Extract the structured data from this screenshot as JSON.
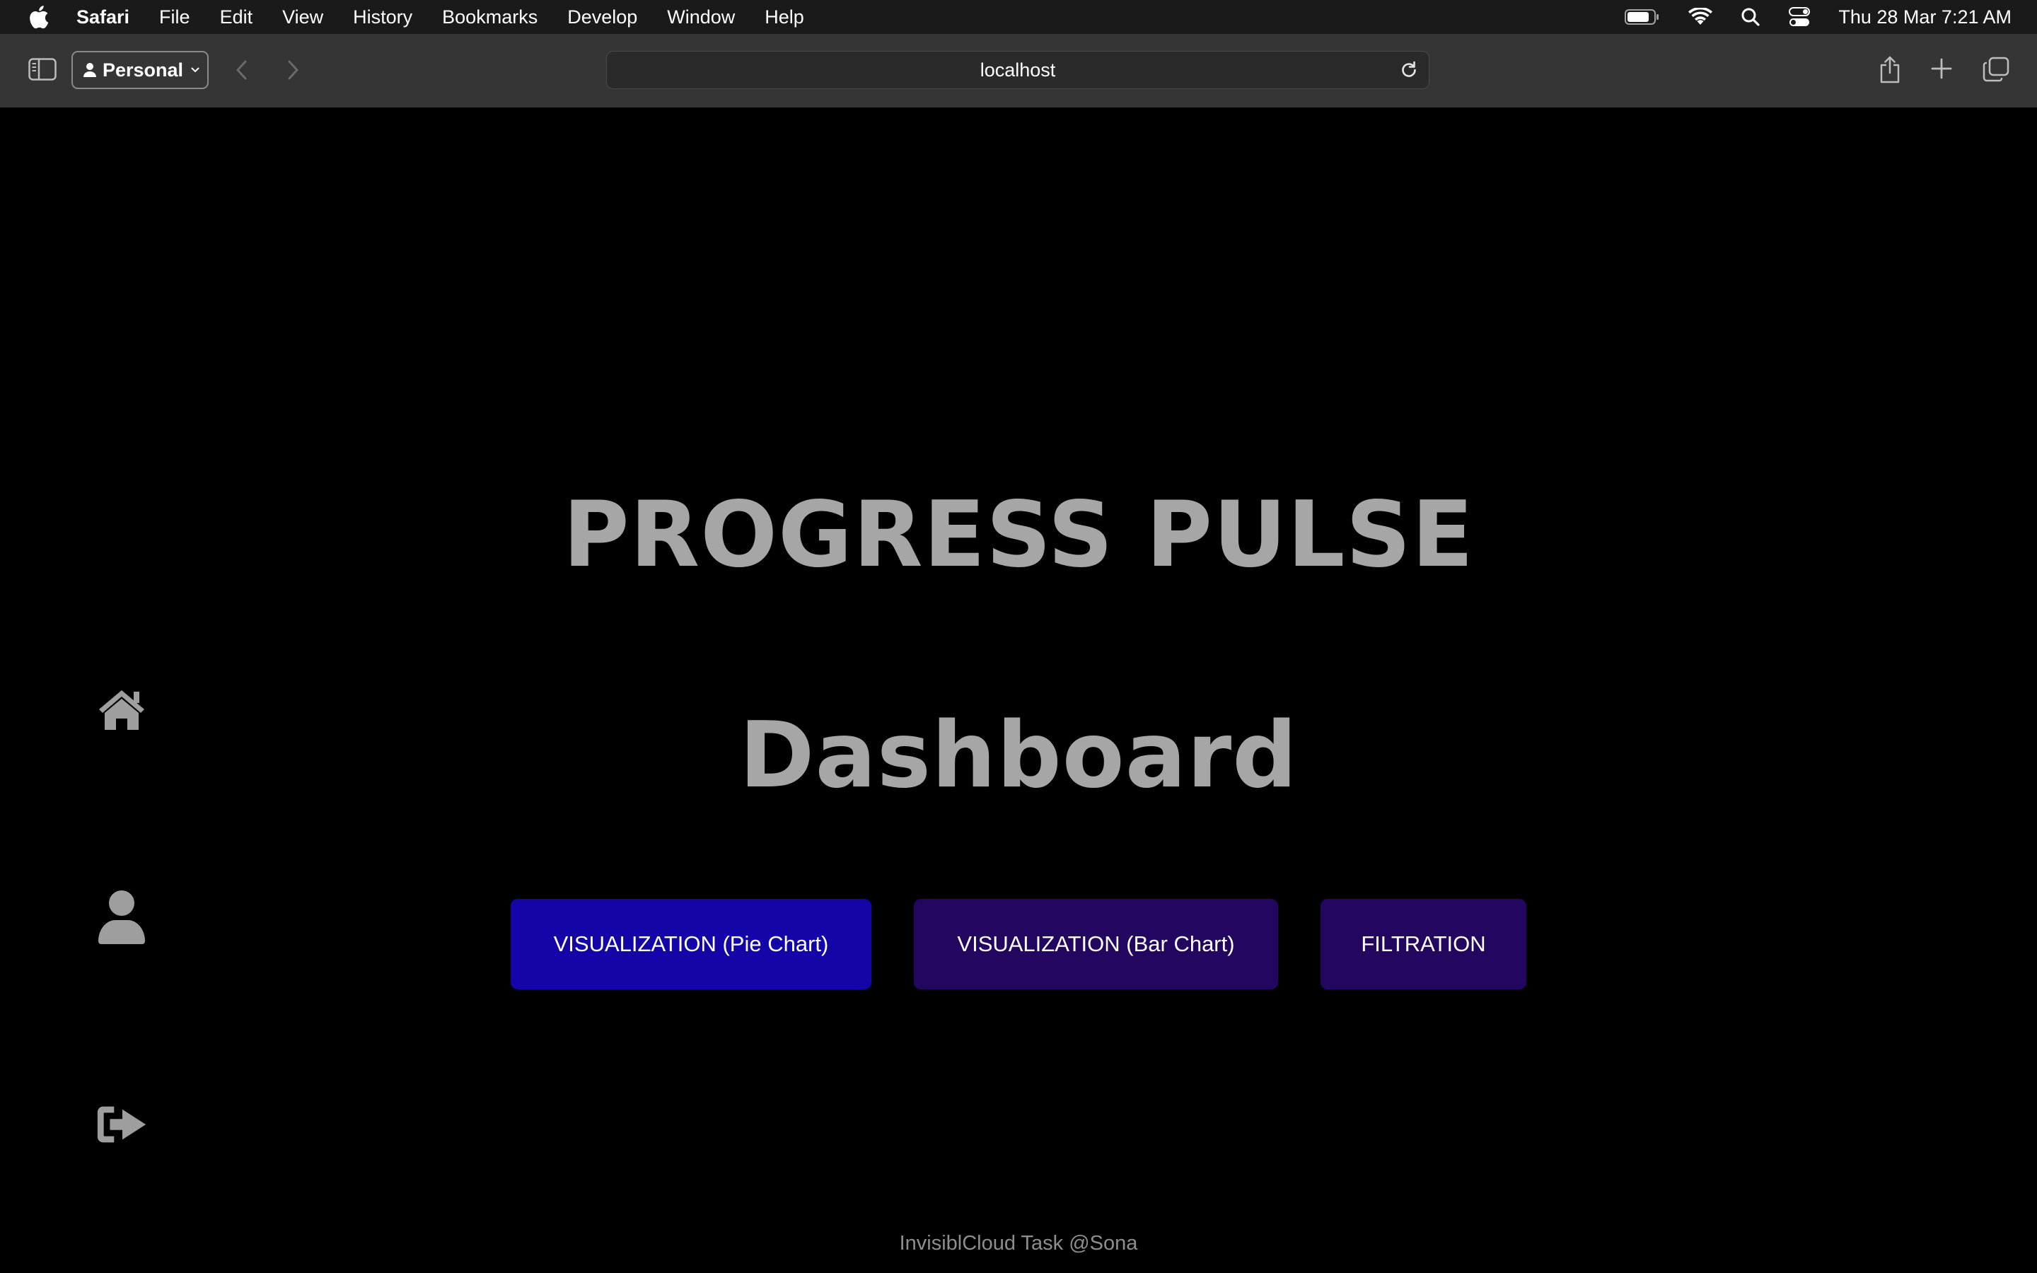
{
  "menubar": {
    "app_name": "Safari",
    "items": [
      "File",
      "Edit",
      "View",
      "History",
      "Bookmarks",
      "Develop",
      "Window",
      "Help"
    ],
    "clock": "Thu 28 Mar  7:21 AM",
    "status_icons": [
      "battery-icon",
      "wifi-icon",
      "spotlight-search-icon",
      "control-center-icon"
    ]
  },
  "toolbar": {
    "profile_label": "Personal",
    "url": "localhost"
  },
  "sidebar": {
    "icons": [
      "home-icon",
      "user-icon",
      "logout-icon"
    ],
    "icon_color": "#9e9e9e"
  },
  "main": {
    "title": "PROGRESS PULSE",
    "subtitle": "Dashboard",
    "title_color": "#a6a6a6",
    "buttons": [
      {
        "label": "VISUALIZATION (Pie Chart)",
        "color": "#1405a8"
      },
      {
        "label": "VISUALIZATION (Bar Chart)",
        "color": "#22065f"
      },
      {
        "label": "FILTRATION",
        "color": "#22065f"
      }
    ]
  },
  "footer": {
    "text": "InvisiblCloud Task @Sona"
  }
}
